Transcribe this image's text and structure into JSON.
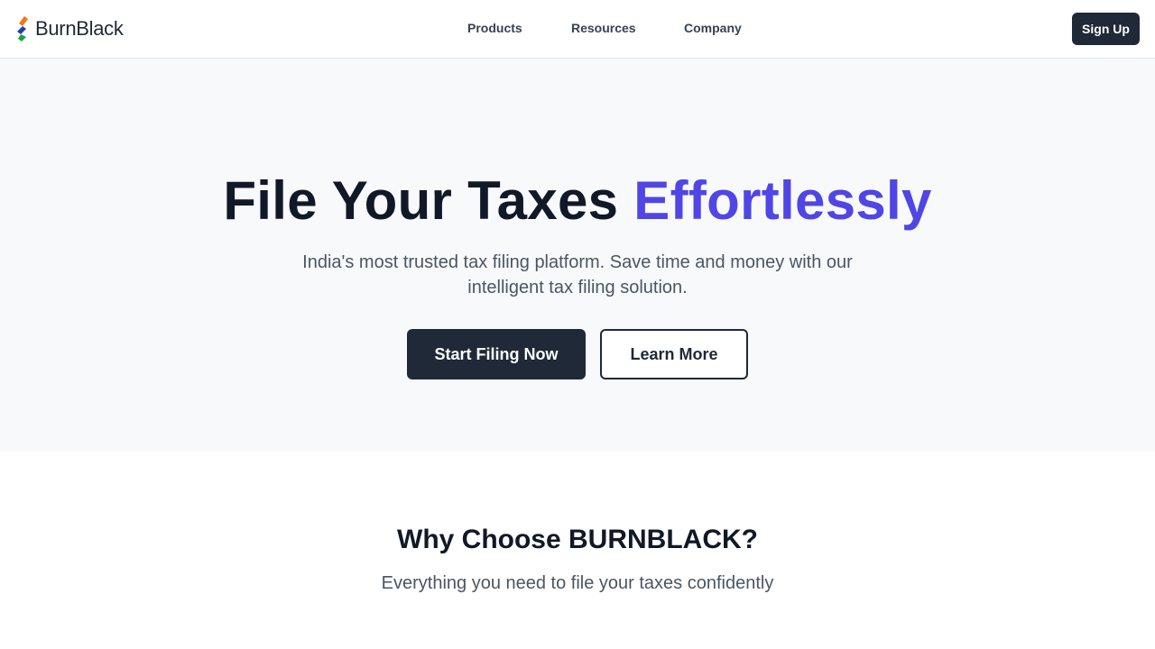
{
  "brand": {
    "name": "BurnBlack",
    "logo_colors": [
      "#f97316",
      "#1e40af",
      "#16a34a"
    ]
  },
  "nav": {
    "links": [
      {
        "label": "Products"
      },
      {
        "label": "Resources"
      },
      {
        "label": "Company"
      }
    ],
    "signup_label": "Sign Up"
  },
  "hero": {
    "title_main": "File Your Taxes ",
    "title_accent": "Effortlessly",
    "subtitle": "India's most trusted tax filing platform. Save time and money with our intelligent tax filing solution.",
    "primary_cta": "Start Filing Now",
    "secondary_cta": "Learn More"
  },
  "features": {
    "title": "Why Choose BURNBLACK?",
    "subtitle": "Everything you need to file your taxes confidently"
  },
  "colors": {
    "accent": "#4f46e5",
    "dark": "#1f2937",
    "hero_bg": "#f8f9fb"
  }
}
